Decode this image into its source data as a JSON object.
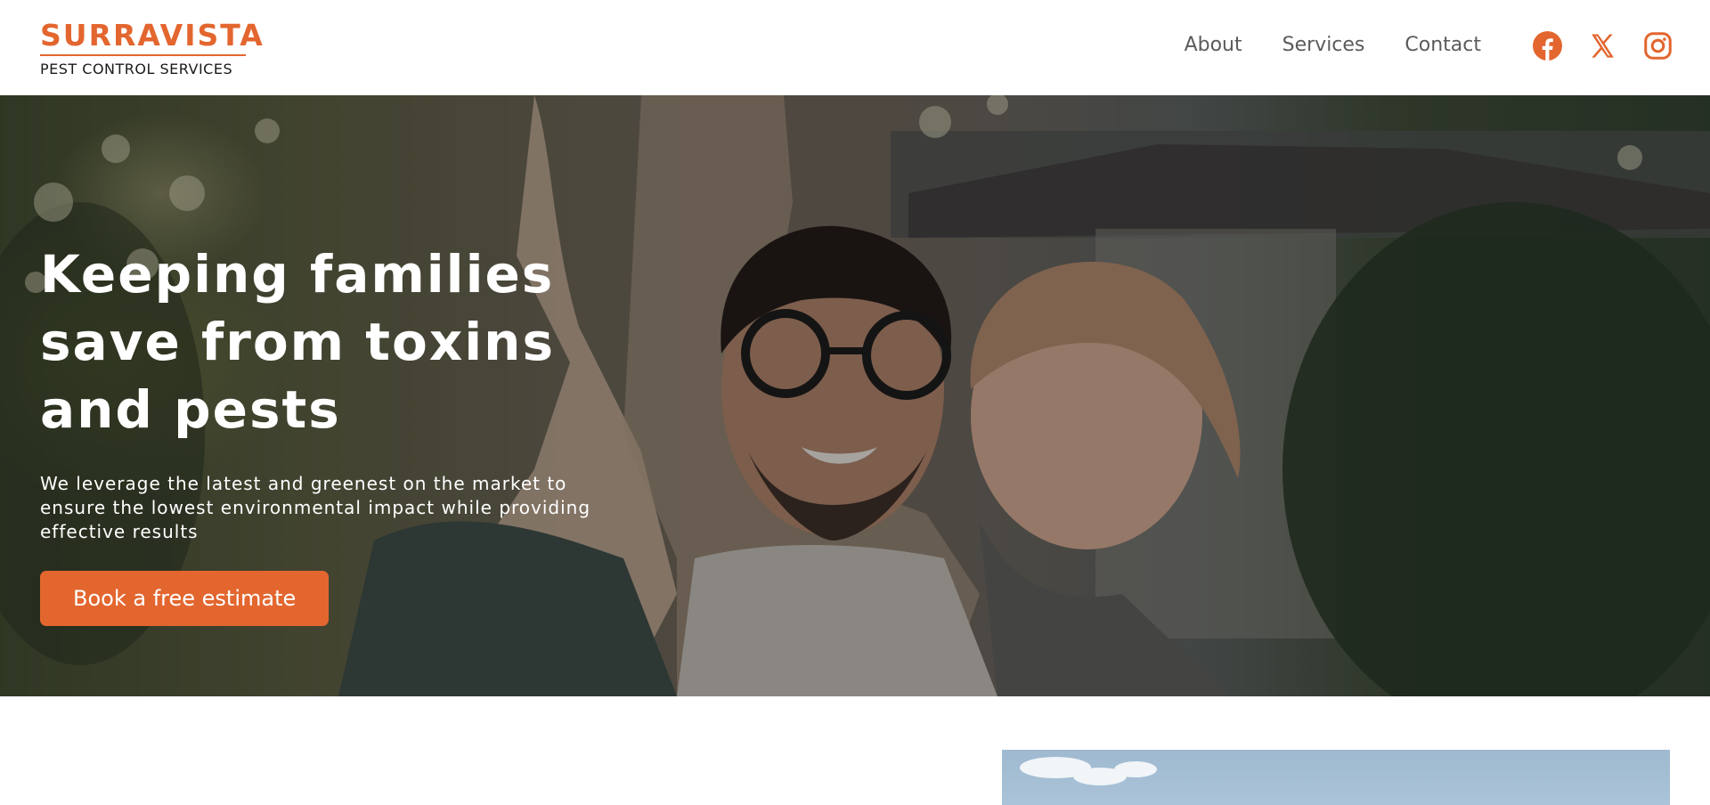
{
  "brand": {
    "name": "SURRAVISTA",
    "tagline": "PEST CONTROL SERVICES",
    "accent_color": "#e3662f"
  },
  "nav": {
    "items": [
      {
        "label": "About"
      },
      {
        "label": "Services"
      },
      {
        "label": "Contact"
      }
    ]
  },
  "socials": [
    {
      "icon": "facebook-icon"
    },
    {
      "icon": "x-icon"
    },
    {
      "icon": "instagram-icon"
    }
  ],
  "hero": {
    "title": "Keeping families save from toxins and pests",
    "subtitle": "We leverage the latest and greenest on the market to ensure the lowest environmental impact while providing effective results",
    "cta_label": "Book a free estimate"
  }
}
